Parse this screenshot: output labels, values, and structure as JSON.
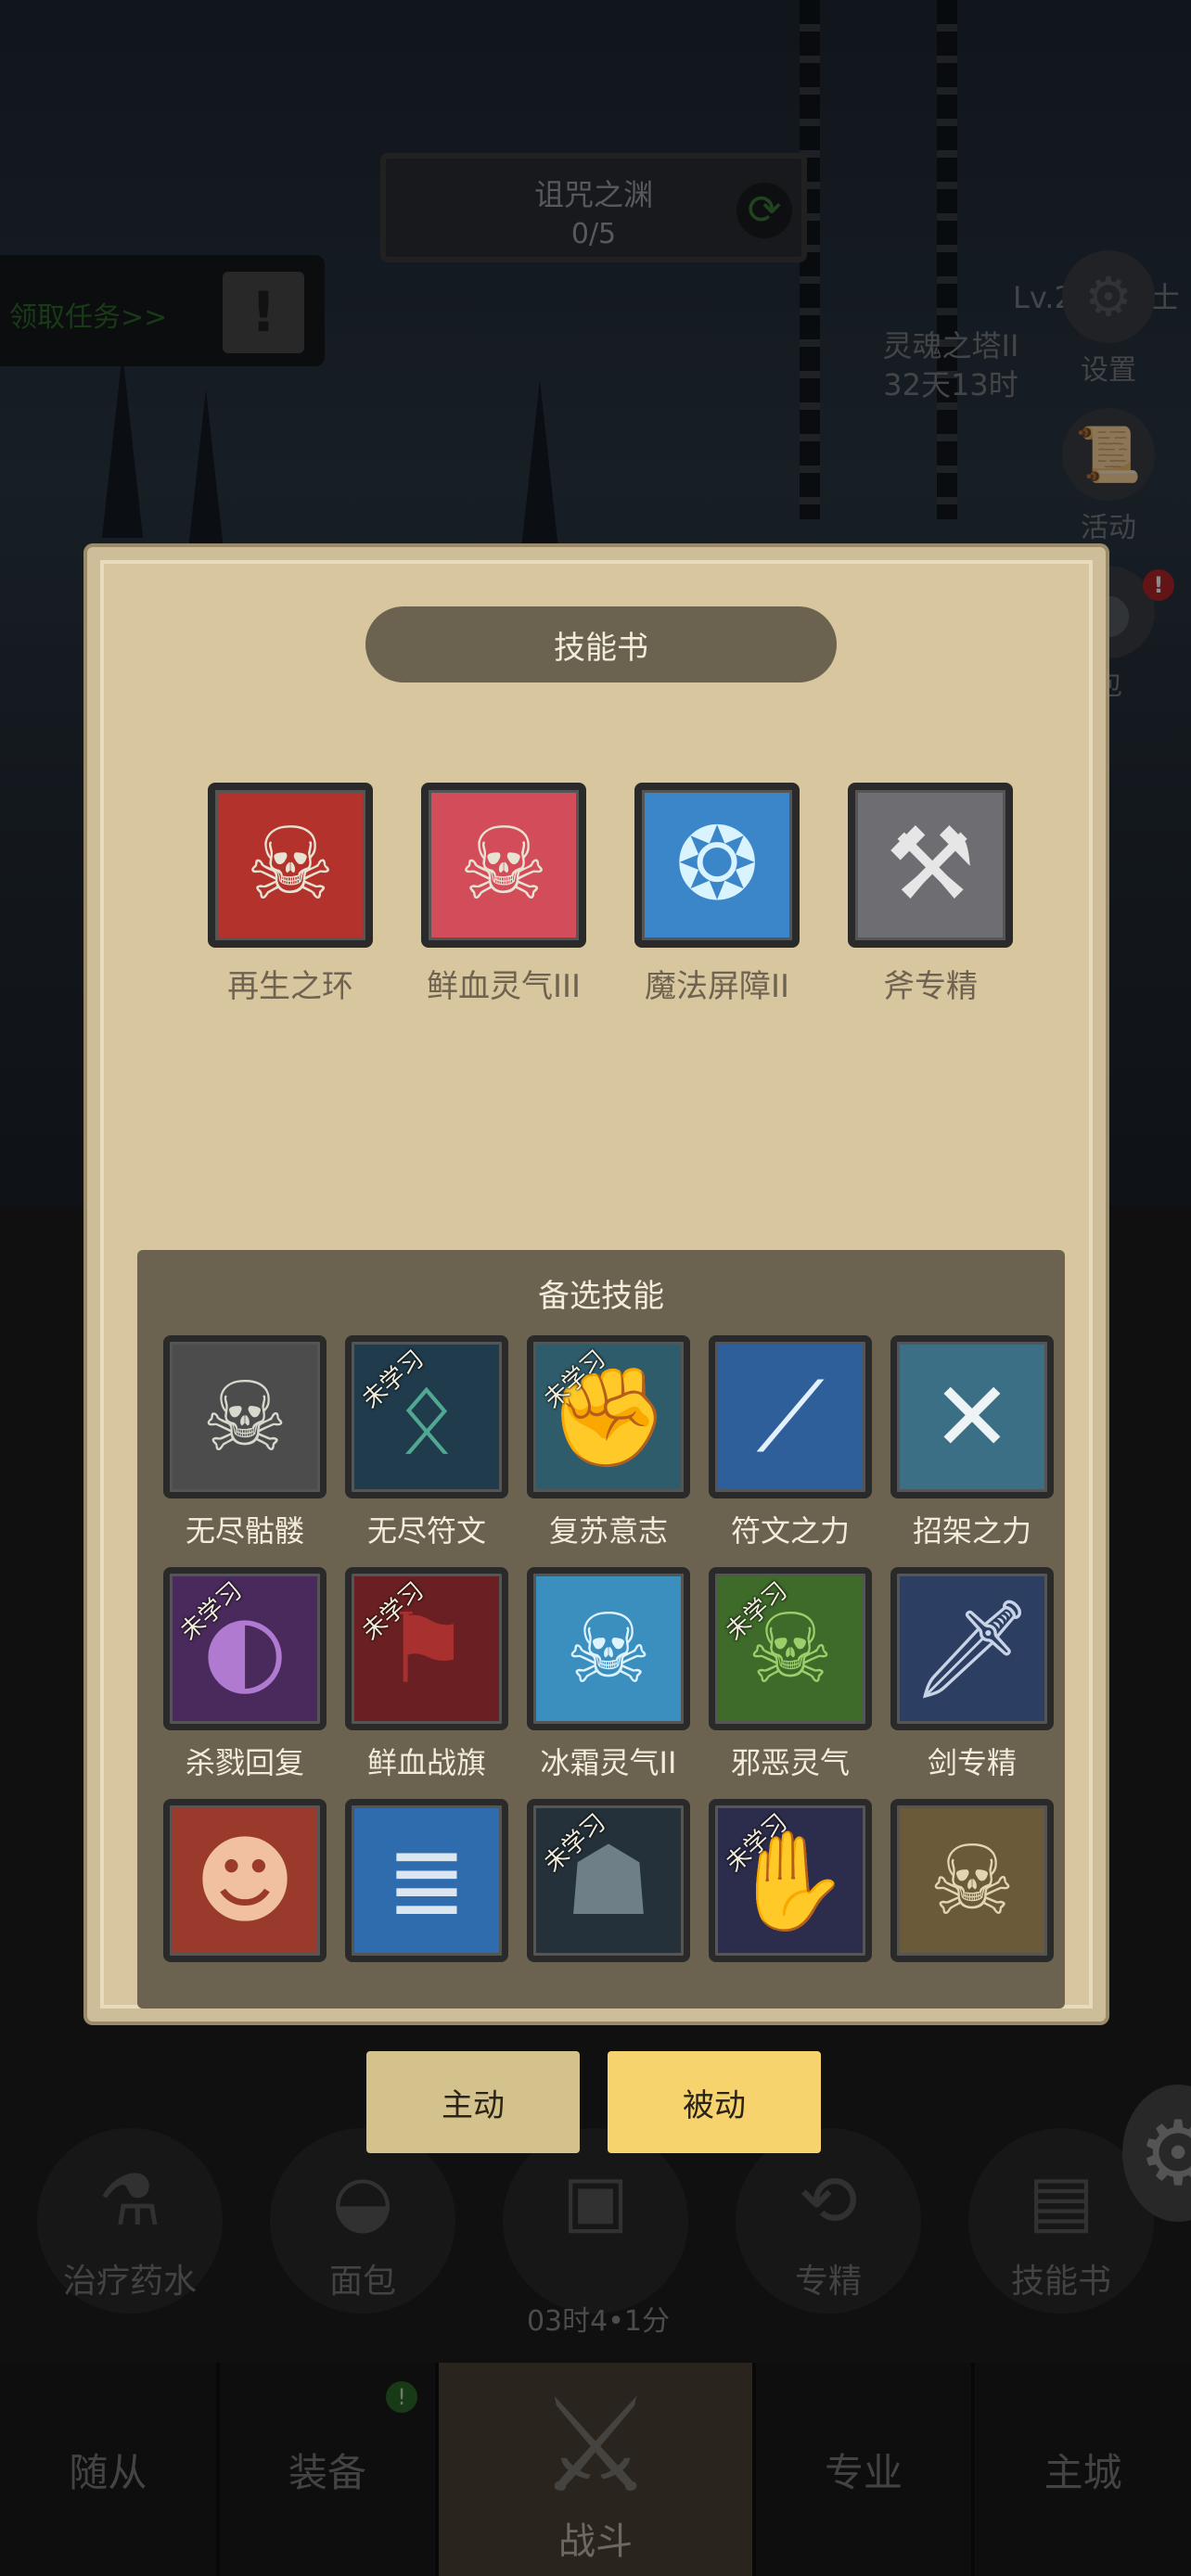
{
  "background": {
    "stage": {
      "title": "诅咒之渊",
      "progress": "0/5"
    },
    "task_label": "领取任务>>",
    "tower": {
      "name": "灵魂之塔II",
      "time": "32天13时"
    },
    "level": "Lv.240 骑士",
    "side": {
      "settings": "设置",
      "activity": "活动",
      "bag": "包"
    }
  },
  "panel": {
    "title": "技能书",
    "equipped": [
      {
        "name": "再生之环",
        "icon": "red-skull-icon",
        "color": "#b3322c"
      },
      {
        "name": "鲜血灵气III",
        "icon": "pink-skull-icon",
        "color": "#d34c5a"
      },
      {
        "name": "魔法屏障II",
        "icon": "magic-shield-icon",
        "color": "#3b86c9"
      },
      {
        "name": "斧专精",
        "icon": "axe-icon",
        "color": "#6e6e72"
      }
    ],
    "reserve_title": "备选技能",
    "unlearned_label": "未学习",
    "reserve": [
      [
        {
          "name": "无尽骷髅",
          "icon": "grey-skull-icon",
          "color": "#4c4c4c",
          "unlearned": false
        },
        {
          "name": "无尽符文",
          "icon": "rune-icon",
          "color": "#1f3b4c",
          "unlearned": true
        },
        {
          "name": "复苏意志",
          "icon": "fist-icon",
          "color": "#2f5c6a",
          "unlearned": true
        },
        {
          "name": "符文之力",
          "icon": "rune-sword-icon",
          "color": "#2e5f9a",
          "unlearned": false
        },
        {
          "name": "招架之力",
          "icon": "crossed-swords-icon",
          "color": "#3b6f86",
          "unlearned": false
        }
      ],
      [
        {
          "name": "杀戮回复",
          "icon": "hooded-face-icon",
          "color": "#4a2a5c",
          "unlearned": true
        },
        {
          "name": "鲜血战旗",
          "icon": "banner-icon",
          "color": "#6a2022",
          "unlearned": true
        },
        {
          "name": "冰霜灵气II",
          "icon": "ice-skull-icon",
          "color": "#3a8fbf",
          "unlearned": false
        },
        {
          "name": "邪恶灵气",
          "icon": "green-skull-icon",
          "color": "#3e6a2a",
          "unlearned": true
        },
        {
          "name": "剑专精",
          "icon": "sword-icon",
          "color": "#2c3f63",
          "unlearned": false
        }
      ],
      [
        {
          "name": "",
          "icon": "demon-face-icon",
          "color": "#9a3a2c",
          "unlearned": false
        },
        {
          "name": "",
          "icon": "spine-icon",
          "color": "#2e6cae",
          "unlearned": false
        },
        {
          "name": "",
          "icon": "dark-maw-icon",
          "color": "#24313a",
          "unlearned": true
        },
        {
          "name": "",
          "icon": "ghost-hand-icon",
          "color": "#2c2c4c",
          "unlearned": true
        },
        {
          "name": "",
          "icon": "bone-skull-icon",
          "color": "#6a5a3a",
          "unlearned": false
        }
      ]
    ]
  },
  "tabs": {
    "active": "主动",
    "passive": "被动"
  },
  "quick": [
    {
      "label": "治疗药水",
      "icon": "potion-icon"
    },
    {
      "label": "面包",
      "icon": "bread-icon"
    },
    {
      "label": "",
      "icon": "chest-icon"
    },
    {
      "label": "专精",
      "icon": "mastery-icon"
    },
    {
      "label": "技能书",
      "icon": "skill-book-icon"
    }
  ],
  "timer": "03时4•1分",
  "nav": {
    "followers": "随从",
    "equipment": "装备",
    "battle": "战斗",
    "profession": "专业",
    "city": "主城",
    "equipment_badge": "!"
  }
}
